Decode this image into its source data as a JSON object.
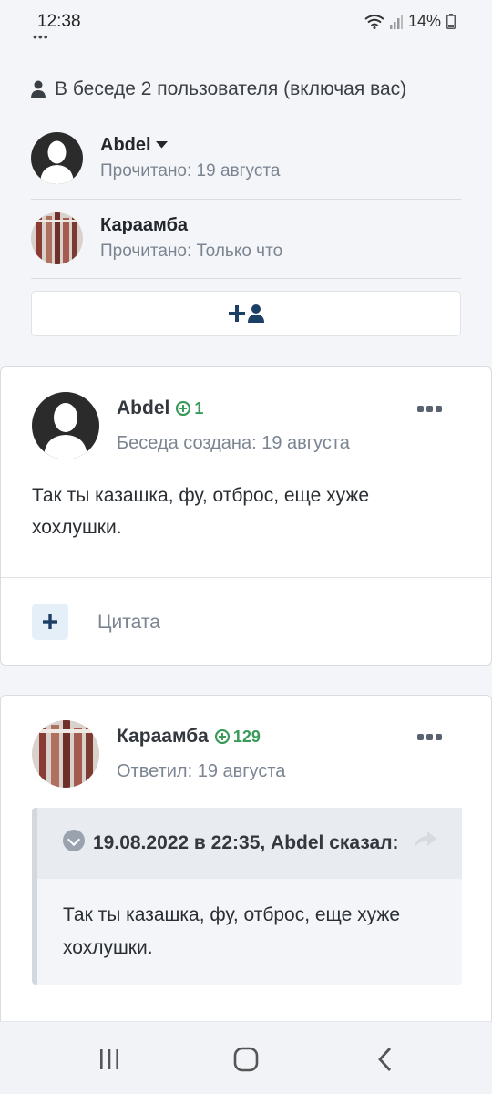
{
  "status": {
    "time": "12:38",
    "battery": "14%"
  },
  "conversation": {
    "participants_text": "В беседе 2 пользователя (включая вас)",
    "participants": [
      {
        "name": "Abdel",
        "read": "Прочитано: 19 августа",
        "avatar": "default-avatar-icon"
      },
      {
        "name": "Караамба",
        "read": "Прочитано: Только что",
        "avatar": "photo-avatar"
      }
    ],
    "invite_icon": "add-user-icon"
  },
  "messages": [
    {
      "author": "Abdel",
      "reputation": "1",
      "subtitle": "Беседа создана: 19 августа",
      "body": "Так ты казашка, фу, отброс, еще хуже хохлушки.",
      "quote_label": "Цитата"
    },
    {
      "author": "Караамба",
      "reputation": "129",
      "subtitle": "Ответил: 19 августа",
      "quote": {
        "header": "19.08.2022 в 22:35, Abdel сказал:",
        "body": "Так ты казашка, фу, отброс, еще хуже хохлушки."
      }
    }
  ],
  "colors": {
    "accent": "#1c3f66",
    "reputation": "#3a9a5a",
    "muted": "#7b8591"
  }
}
